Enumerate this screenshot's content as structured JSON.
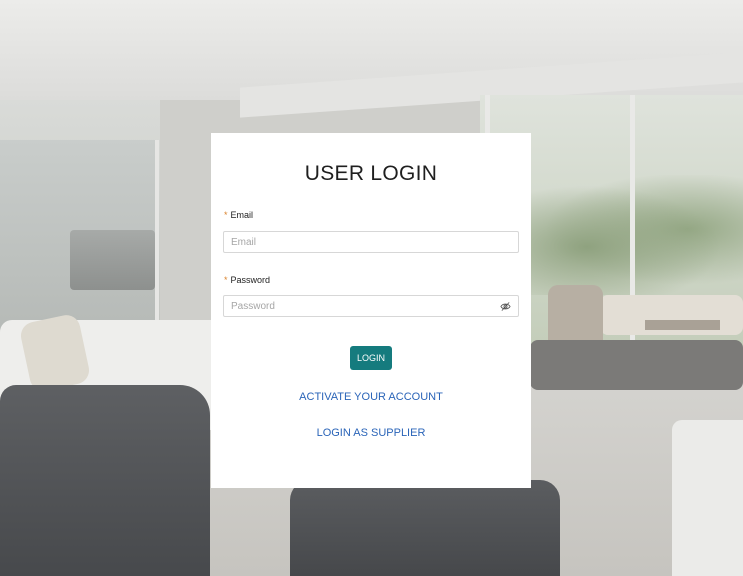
{
  "background": {
    "description_icon": "living-room-photo"
  },
  "login": {
    "title": "USER LOGIN",
    "email": {
      "required_mark": "*",
      "label": "Email",
      "placeholder": "Email",
      "value": ""
    },
    "password": {
      "required_mark": "*",
      "label": "Password",
      "placeholder": "Password",
      "value": "",
      "toggle_icon": "eye-slash-icon"
    },
    "submit_label": "LOGIN",
    "activate_link": "ACTIVATE YOUR ACCOUNT",
    "supplier_link": "LOGIN AS SUPPLIER"
  },
  "colors": {
    "primary_button": "#157b7e",
    "link": "#2a64b8",
    "required": "#d9822b"
  }
}
